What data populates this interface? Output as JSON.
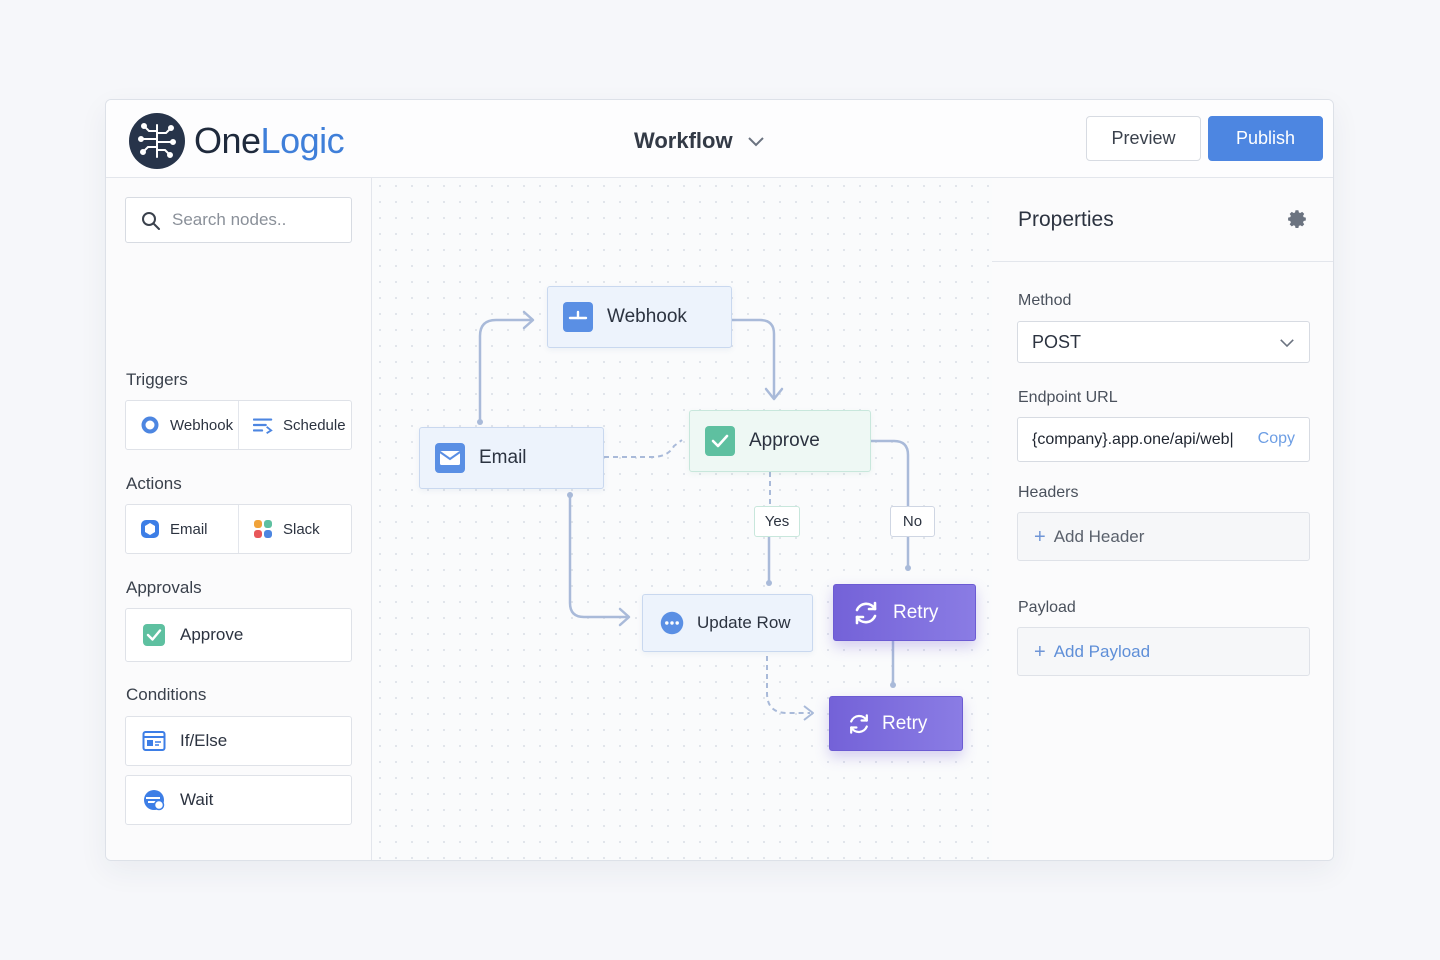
{
  "header": {
    "logo_part1": "One",
    "logo_part2": "Logic",
    "workflow_title": "Workflow",
    "preview_label": "Preview",
    "publish_label": "Publish"
  },
  "sidebar": {
    "search_placeholder": "Search nodes..",
    "sections": {
      "triggers": {
        "label": "Triggers",
        "items": [
          "Webhook",
          "Schedule"
        ]
      },
      "actions": {
        "label": "Actions",
        "items": [
          "Email",
          "Slack"
        ]
      },
      "approvals": {
        "label": "Approvals",
        "items": [
          "Approve"
        ]
      },
      "conditions": {
        "label": "Conditions",
        "items": [
          "If/Else",
          "Wait"
        ]
      }
    }
  },
  "canvas": {
    "nodes": {
      "webhook": "Webhook",
      "email": "Email",
      "approve": "Approve",
      "update_row": "Update Row",
      "retry_1": "Retry",
      "retry_2": "Retry"
    },
    "branch_labels": {
      "yes": "Yes",
      "no": "No"
    }
  },
  "properties": {
    "title": "Properties",
    "method_label": "Method",
    "method_value": "POST",
    "endpoint_label": "Endpoint URL",
    "endpoint_value": "{company}.app.one/api/web|",
    "copy_label": "Copy",
    "headers_label": "Headers",
    "add_header_label": "Add Header",
    "payload_label": "Payload",
    "add_payload_label": "Add Payload"
  },
  "colors": {
    "brand_dark": "#1f2a3c",
    "brand_blue": "#3f7fd9",
    "publish": "#4d86e1",
    "approve_green": "#5ec0a0",
    "retry_purple": "#7462d8"
  },
  "icons": {
    "logo": "circuit-brain-icon",
    "search": "search-icon",
    "webhook": "webhook-icon",
    "schedule": "schedule-icon",
    "email": "email-icon",
    "slack": "slack-icon",
    "approve": "check-icon",
    "ifelse": "ifelse-icon",
    "wait": "wait-icon",
    "update_row": "more-dots-icon",
    "retry": "retry-icon",
    "gear": "gear-icon"
  }
}
